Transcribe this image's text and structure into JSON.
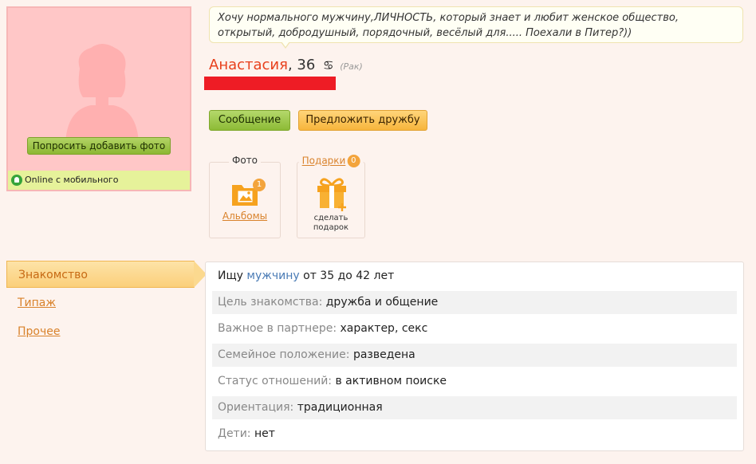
{
  "profile": {
    "ask_photo_label": "Попросить добавить фото",
    "online_status": "Online с мобильного",
    "status_text": "Хочу нормального мужчину,ЛИЧНОСТЬ, который знает и любит женское общество, открытый, добродушный, порядочный, весёлый для..... Поехали в Питер?))",
    "name": "Анастасия",
    "age_text": ", 36",
    "zodiac_symbol": "♋",
    "zodiac_name": "(Рак)",
    "redaction_color": "#ee1c25"
  },
  "actions": {
    "message_label": "Сообщение",
    "friend_label": "Предложить дружбу"
  },
  "features": {
    "photo_title": "Фото",
    "albums_count": "1",
    "albums_label": "Альбомы",
    "gifts_title": "Подарки",
    "gifts_count": "0",
    "gift_line1": "сделать",
    "gift_line2": "подарок"
  },
  "side_menu": {
    "items": [
      {
        "label": "Знакомство",
        "active": true
      },
      {
        "label": "Типаж",
        "active": false
      },
      {
        "label": "Прочее",
        "active": false
      }
    ]
  },
  "info": {
    "seek_prefix": "Ищу",
    "seek_gender": "мужчину",
    "seek_range": "от 35 до 42 лет",
    "rows": [
      {
        "label": "Цель знакомства:",
        "value": "дружба и общение"
      },
      {
        "label": "Важное в партнере:",
        "value": "характер, секс"
      },
      {
        "label": "Семейное положение:",
        "value": "разведена"
      },
      {
        "label": "Статус отношений:",
        "value": "в активном поиске"
      },
      {
        "label": "Ориентация:",
        "value": "традиционная"
      },
      {
        "label": "Дети:",
        "value": "нет"
      }
    ]
  },
  "colors": {
    "accent_orange": "#d9822b",
    "name_red": "#e8401c",
    "link_blue": "#4a7bb5"
  }
}
